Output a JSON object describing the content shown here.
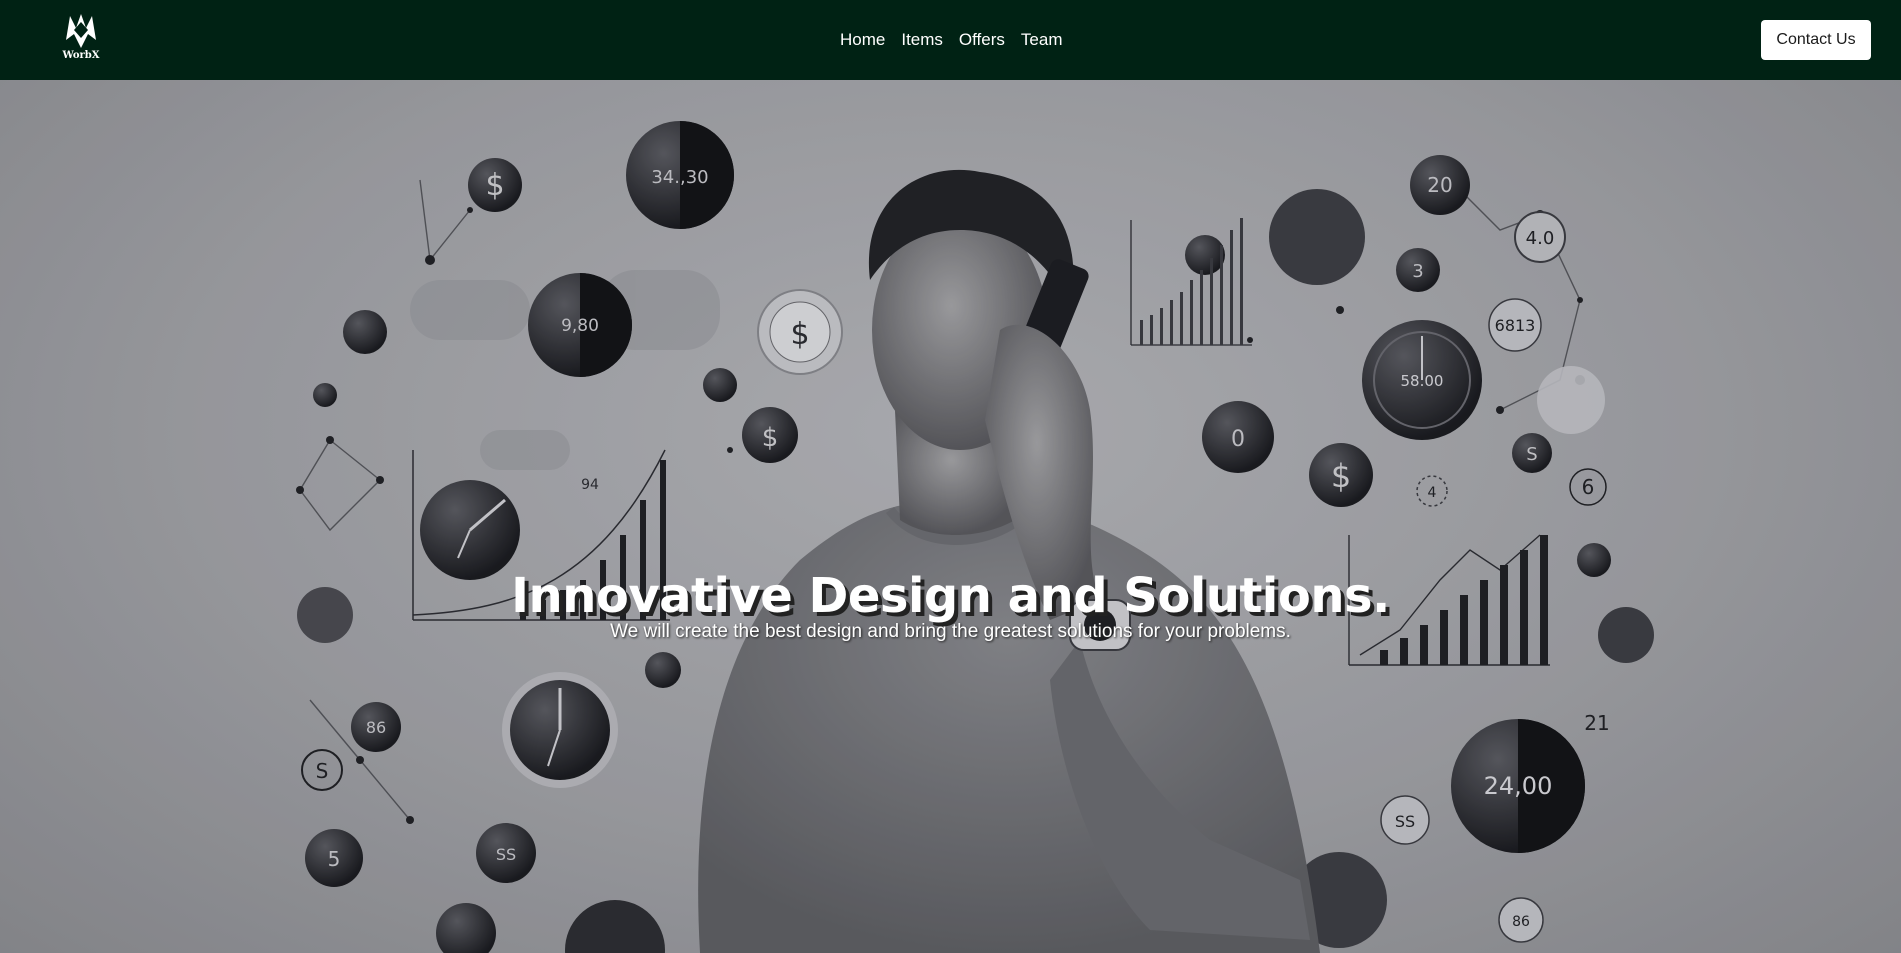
{
  "brand": {
    "logo_text": "WorbX"
  },
  "nav": {
    "links": [
      {
        "label": "Home"
      },
      {
        "label": "Items"
      },
      {
        "label": "Offers"
      },
      {
        "label": "Team"
      }
    ],
    "cta_label": "Contact Us"
  },
  "hero": {
    "title": "Innovative Design and Solutions.",
    "subtitle": "We will create the best design and bring the greatest solutions for your problems.",
    "art_labels": {
      "l1": "34.,30",
      "l2": "9,80",
      "l3": "58.00",
      "l4": "24,00",
      "l5": "20",
      "l6": "4.0",
      "l7": "3",
      "l8": "6813",
      "l9": "0",
      "l10": "6",
      "l11": "86",
      "l12": "5",
      "l13": "SS",
      "l14": "94",
      "l15": "4",
      "l16": "21",
      "l17": "86"
    }
  },
  "colors": {
    "navbar_bg": "#002214",
    "cta_bg": "#ffffff",
    "hero_text": "#ffffff"
  }
}
